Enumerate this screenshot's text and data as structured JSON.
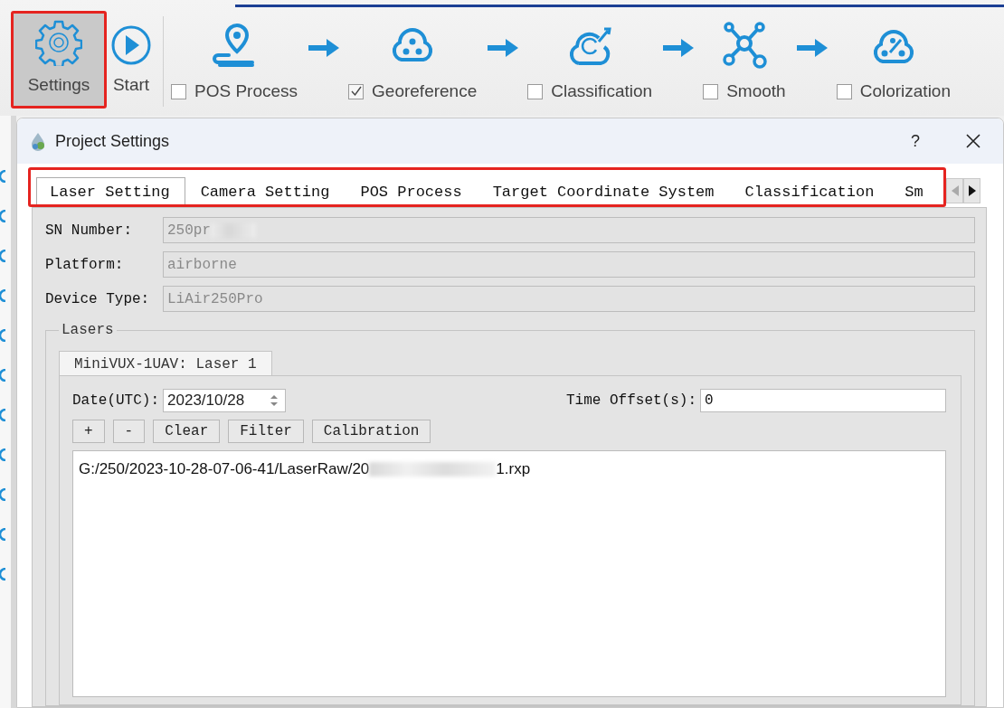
{
  "toolbar": {
    "buttons": [
      {
        "label": "Settings",
        "kind": "settings",
        "selected": true,
        "highlighted": true
      },
      {
        "label": "Start",
        "kind": "start",
        "selected": false,
        "highlighted": false
      }
    ],
    "steps": [
      {
        "label": "POS Process",
        "kind": "pos",
        "checked": false
      },
      {
        "label": "Georeference",
        "kind": "georeference",
        "checked": true
      },
      {
        "label": "Classification",
        "kind": "classification",
        "checked": false
      },
      {
        "label": "Smooth",
        "kind": "smooth",
        "checked": false
      },
      {
        "label": "Colorization",
        "kind": "colorization",
        "checked": false
      }
    ]
  },
  "dialog": {
    "title": "Project Settings",
    "help": "?",
    "tabs_highlighted": true,
    "tabs": [
      {
        "label": "Laser Setting",
        "selected": true
      },
      {
        "label": "Camera Setting",
        "selected": false
      },
      {
        "label": "POS Process",
        "selected": false
      },
      {
        "label": "Target Coordinate System",
        "selected": false
      },
      {
        "label": "Classification",
        "selected": false
      },
      {
        "label": "Sm",
        "selected": false
      }
    ],
    "fields": [
      {
        "label": "SN Number:",
        "value": "250pr",
        "redacted": true,
        "disabled": true
      },
      {
        "label": "Platform:",
        "value": "airborne",
        "redacted": false,
        "disabled": true
      },
      {
        "label": "Device Type:",
        "value": "LiAir250Pro",
        "redacted": false,
        "disabled": true
      }
    ],
    "lasers": {
      "title": "Lasers",
      "tabs": [
        {
          "label": "MiniVUX-1UAV: Laser 1",
          "selected": true
        }
      ],
      "date_label": "Date(UTC):",
      "date_value": "2023/10/28",
      "offset_label": "Time Offset(s):",
      "offset_value": "0",
      "buttons": [
        "+",
        "-",
        "Clear",
        "Filter",
        "Calibration"
      ],
      "files": [
        {
          "start": "G:/250/2023-10-28-07-06-41/LaserRaw/20",
          "redacted": true,
          "end": "1.rxp"
        }
      ]
    }
  }
}
